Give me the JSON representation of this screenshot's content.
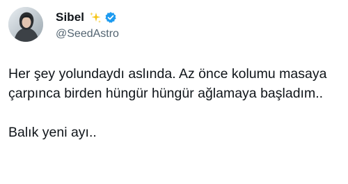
{
  "author": {
    "display_name": "Sibel",
    "handle": "@SeedAstro",
    "badge_icons": [
      "sparkles-icon",
      "verified-badge-icon"
    ],
    "verified_color": "#1d9bf0",
    "sparkle_color": "#f5c518"
  },
  "tweet": {
    "paragraph_1": "Her şey yolundaydı aslında. Az önce kolumu masaya çarpınca birden hüngür hüngür ağlamaya başladım..",
    "paragraph_2": "Balık yeni ayı.."
  }
}
